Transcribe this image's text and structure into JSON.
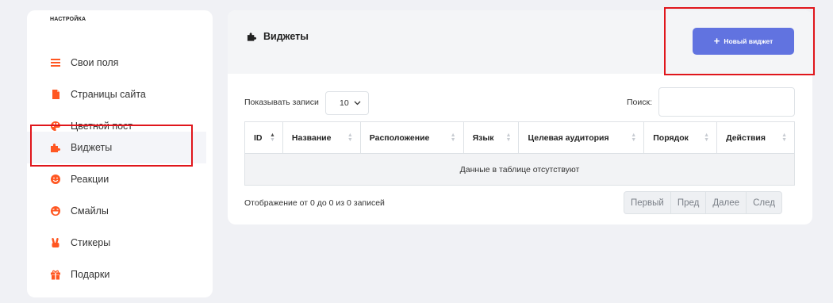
{
  "sidebar": {
    "title": "НАСТРОЙКА",
    "items": [
      {
        "label": "Свои поля",
        "icon": "menu-lines-icon"
      },
      {
        "label": "Страницы сайта",
        "icon": "file-icon"
      },
      {
        "label": "Цветной пост",
        "icon": "palette-icon"
      },
      {
        "label": "Виджеты",
        "icon": "puzzle-icon",
        "active": true
      },
      {
        "label": "Реакции",
        "icon": "smile-icon"
      },
      {
        "label": "Смайлы",
        "icon": "laugh-icon"
      },
      {
        "label": "Стикеры",
        "icon": "peace-hand-icon"
      },
      {
        "label": "Подарки",
        "icon": "gift-icon"
      }
    ]
  },
  "header": {
    "title": "Виджеты",
    "icon": "puzzle-icon",
    "new_button_label": "Новый виджет"
  },
  "table_controls": {
    "length_label": "Показывать записи",
    "length_value": "10",
    "search_label": "Поиск:"
  },
  "table": {
    "columns": [
      "ID",
      "Название",
      "Расположение",
      "Язык",
      "Целевая аудитория",
      "Порядок",
      "Действия"
    ],
    "empty_message": "Данные в таблице отсутствуют"
  },
  "footer": {
    "info": "Отображение от 0 до 0 из 0 записей",
    "pagination": [
      "Первый",
      "Пред",
      "Далее",
      "След"
    ]
  },
  "colors": {
    "accent": "#6173e0",
    "icon_orange": "#ff5722",
    "highlight_red": "#e0161c"
  }
}
